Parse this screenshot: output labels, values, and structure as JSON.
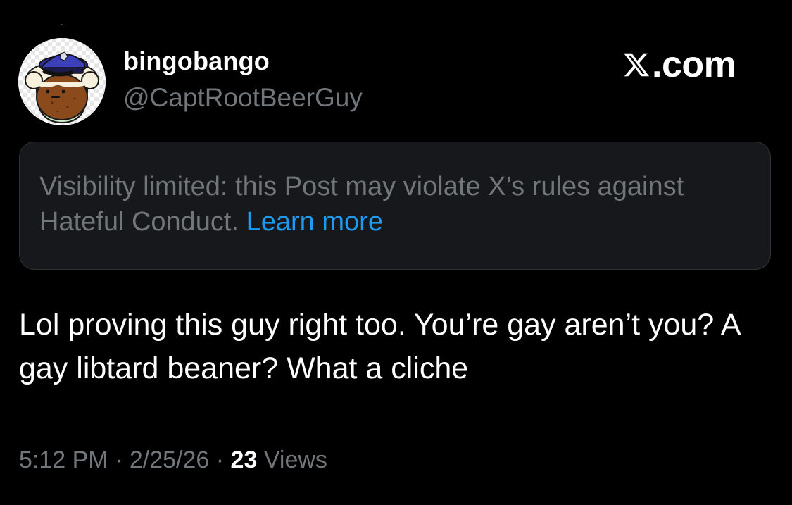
{
  "author": {
    "display_name": "bingobango",
    "handle": "@CaptRootBeerGuy",
    "avatar_icon": "root-beer-captain-avatar"
  },
  "brand": {
    "icon": "x-logo-icon",
    "text": ".com"
  },
  "notice": {
    "text": "Visibility limited: this Post may violate X’s rules against Hateful Conduct.",
    "link_label": "Learn more",
    "link_color": "#1d9bf0"
  },
  "post": {
    "text": "Lol proving this guy right too. You’re gay aren’t you? A gay libtard beaner? What a cliche"
  },
  "meta": {
    "time": "5:12 PM",
    "separator": "·",
    "date": "2/25/26",
    "views_count": "23",
    "views_label": "Views"
  },
  "colors": {
    "background": "#000000",
    "text_primary": "#ffffff",
    "text_secondary": "#71767b",
    "notice_background": "#16181c",
    "notice_border": "#2f3336"
  }
}
